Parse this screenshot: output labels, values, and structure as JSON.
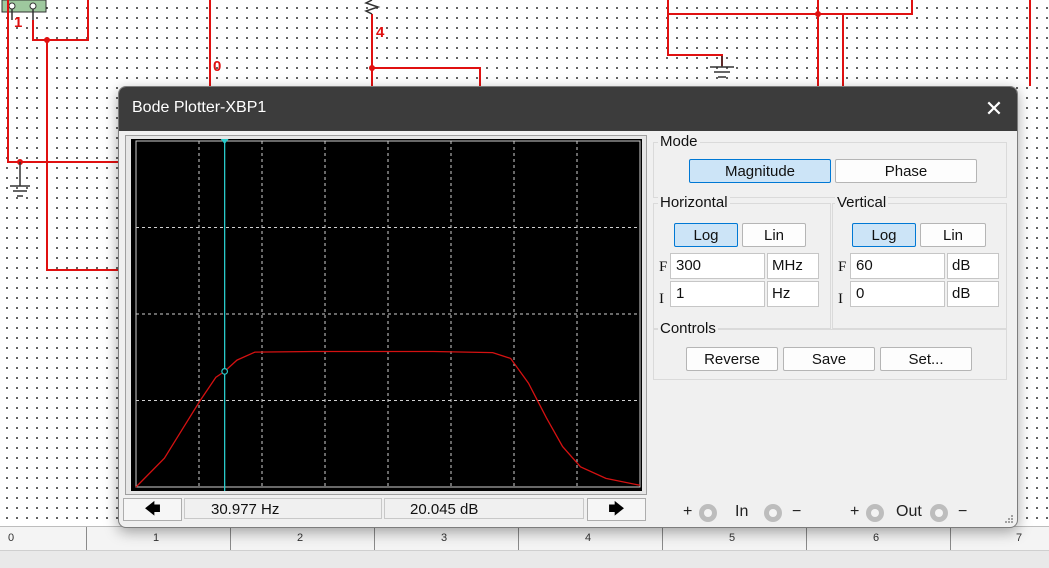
{
  "window": {
    "title": "Bode Plotter-XBP1",
    "close_glyph": "✕"
  },
  "circuit": {
    "node_labels": [
      "1",
      "0",
      "4"
    ]
  },
  "ruler": {
    "marks": [
      "0",
      "1",
      "2",
      "3",
      "4",
      "5",
      "6",
      "7"
    ]
  },
  "mode": {
    "label": "Mode",
    "magnitude": "Magnitude",
    "phase": "Phase",
    "active": "Magnitude"
  },
  "horizontal": {
    "label": "Horizontal",
    "log": "Log",
    "lin": "Lin",
    "active": "Log",
    "final_label": "F",
    "final_value": "300",
    "final_unit": "MHz",
    "initial_label": "I",
    "initial_value": "1",
    "initial_unit": "Hz"
  },
  "vertical": {
    "label": "Vertical",
    "log": "Log",
    "lin": "Lin",
    "active": "Log",
    "final_label": "F",
    "final_value": "60",
    "final_unit": "dB",
    "initial_label": "I",
    "initial_value": "0",
    "initial_unit": "dB"
  },
  "controls": {
    "label": "Controls",
    "reverse": "Reverse",
    "save": "Save",
    "set": "Set..."
  },
  "readout": {
    "frequency": "30.977  Hz",
    "gain": "20.045 dB",
    "left_arrow": "🡄",
    "right_arrow": "🡆"
  },
  "terminals": {
    "in_label": "In",
    "out_label": "Out",
    "plus": "+",
    "minus": "−"
  },
  "chart_data": {
    "type": "line",
    "title": "",
    "xlabel": "",
    "ylabel": "",
    "x_scale": "log",
    "xlim_hz": [
      1,
      300000000
    ],
    "ylim_db": [
      0,
      60
    ],
    "grid": true,
    "series": [
      {
        "color": "#d41111",
        "x_hz": [
          1,
          3,
          6,
          12,
          22,
          30.977,
          50,
          100,
          1000,
          100000,
          1000000,
          2000000,
          4000000,
          8000000,
          15000000,
          30000000,
          80000000,
          300000000
        ],
        "y_db": [
          0,
          5,
          10,
          15,
          19,
          20.045,
          22,
          23.4,
          23.5,
          23.5,
          23.3,
          22.3,
          18,
          12,
          7,
          3.5,
          1.5,
          0.3
        ]
      }
    ],
    "cursor": {
      "x_hz": 30.977,
      "y_db": 20.045,
      "color": "#29c9c9"
    }
  },
  "colors": {
    "wire": "#e01010",
    "plot_bg": "#000000",
    "grid": "#d0d0d0",
    "active_button": "#cce4f7",
    "titlebar": "#3c3c3c"
  }
}
